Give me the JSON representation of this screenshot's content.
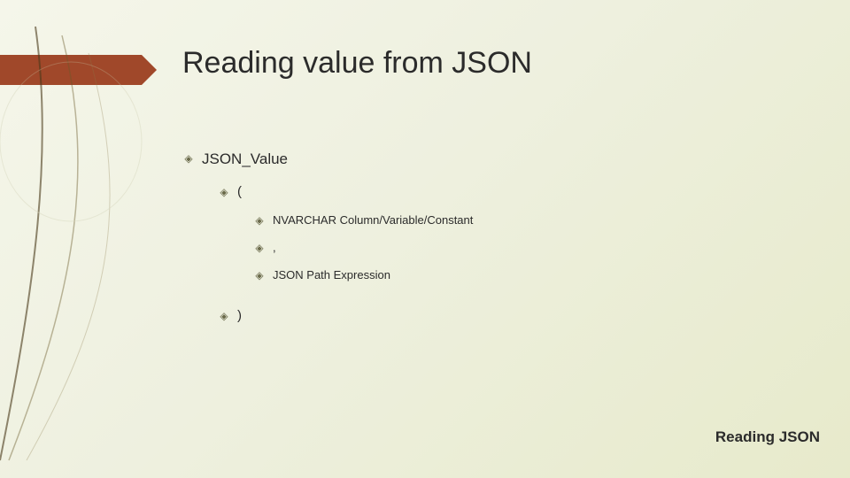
{
  "title": "Reading value from JSON",
  "bullets": {
    "lvl1": [
      {
        "label": "JSON_Value",
        "children": [
          {
            "label": "(",
            "children": [
              {
                "label": "NVARCHAR Column/Variable/Constant"
              },
              {
                "label": ","
              },
              {
                "label": "JSON Path Expression"
              }
            ]
          },
          {
            "label": ")"
          }
        ]
      }
    ]
  },
  "footer": "Reading JSON"
}
